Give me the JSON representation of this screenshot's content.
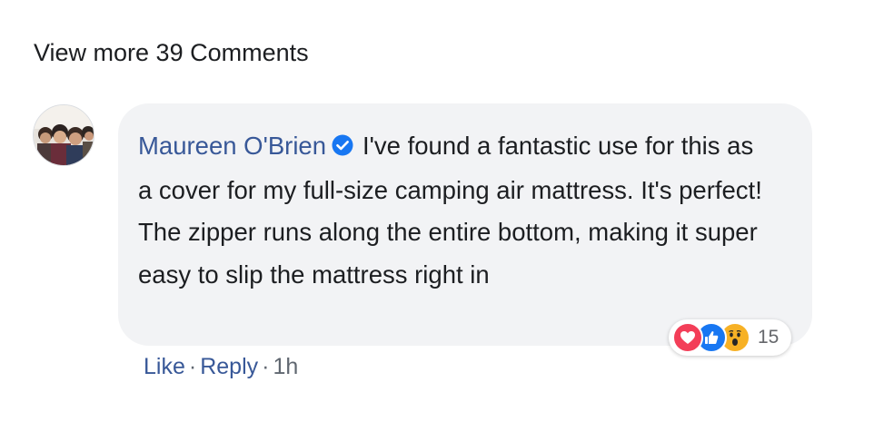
{
  "comments_section": {
    "view_more_label": "View more 39 Comments"
  },
  "comment": {
    "author": "Maureen O'Brien",
    "author_verified": true,
    "text": "I've found a fantastic use for this as a cover for my full-size camping air mattress. It's perfect! The zipper runs along the entire bottom, making it super easy to slip the mattress right in",
    "avatar_icon": "group-photo-avatar",
    "reactions": {
      "icons": [
        "love-icon",
        "like-icon",
        "wow-icon"
      ],
      "count": "15"
    },
    "actions": {
      "like_label": "Like",
      "separator": "·",
      "reply_label": "Reply",
      "timestamp": "1h"
    }
  },
  "colors": {
    "link_blue": "#385898",
    "bubble_bg": "#f2f3f5",
    "text": "#1c1e21",
    "meta_gray": "#606770",
    "verified_blue": "#1877f2",
    "love_red": "#f33e58",
    "like_blue": "#1877f2",
    "wow_yellow": "#f7b125"
  }
}
